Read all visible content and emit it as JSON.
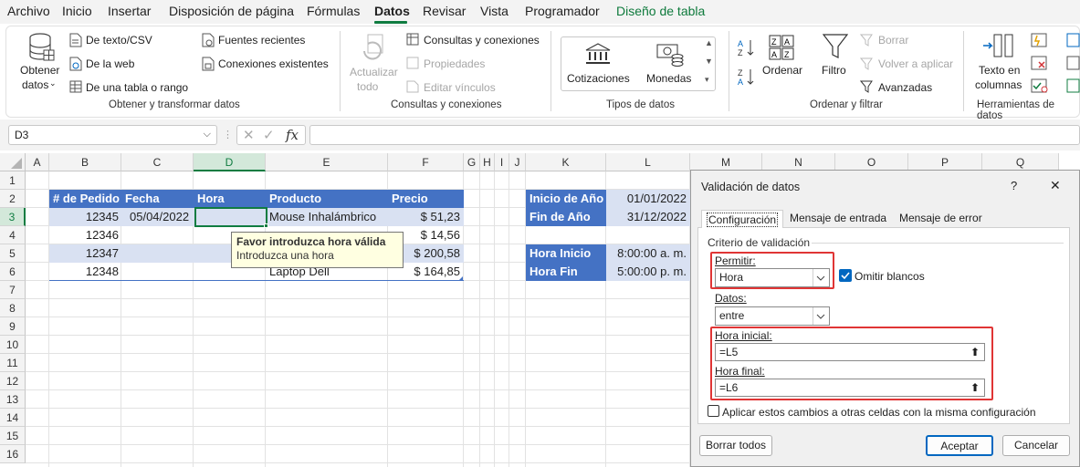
{
  "menu": {
    "items": [
      "Archivo",
      "Inicio",
      "Insertar",
      "Disposición de página",
      "Fórmulas",
      "Datos",
      "Revisar",
      "Vista",
      "Programador",
      "Diseño de tabla"
    ]
  },
  "ribbon": {
    "obtener": {
      "big_label_1": "Obtener",
      "big_label_2": "datos",
      "texto_csv": "De texto/CSV",
      "web": "De la web",
      "tabla_rango": "De una tabla o rango",
      "fuentes_recientes": "Fuentes recientes",
      "conexiones_existentes": "Conexiones existentes",
      "group_label": "Obtener y transformar datos"
    },
    "consultas": {
      "actualizar_1": "Actualizar",
      "actualizar_2": "todo",
      "consultas_conexiones": "Consultas y conexiones",
      "propiedades": "Propiedades",
      "editar_vinculos": "Editar vínculos",
      "group_label": "Consultas y conexiones"
    },
    "tipos": {
      "cotizaciones": "Cotizaciones",
      "monedas": "Monedas",
      "group_label": "Tipos de datos"
    },
    "ordenar": {
      "ordenar": "Ordenar",
      "filtro": "Filtro",
      "borrar": "Borrar",
      "volver_aplicar": "Volver a aplicar",
      "avanzadas": "Avanzadas",
      "group_label": "Ordenar y filtrar"
    },
    "herramientas": {
      "texto_1": "Texto en",
      "texto_2": "columnas",
      "group_label": "Herramientas de datos"
    }
  },
  "formula_bar": {
    "name_box": "D3",
    "fx": "fx",
    "formula": ""
  },
  "columns": [
    "A",
    "B",
    "C",
    "D",
    "E",
    "F",
    "G",
    "H",
    "I",
    "J",
    "K",
    "L",
    "M",
    "N",
    "O",
    "P",
    "Q"
  ],
  "rows": [
    "1",
    "2",
    "3",
    "4",
    "5",
    "6",
    "7",
    "8",
    "9",
    "10",
    "11",
    "12",
    "13",
    "14",
    "15",
    "16"
  ],
  "table": {
    "headers": [
      "# de Pedido",
      "Fecha",
      "Hora",
      "Producto",
      "Precio"
    ],
    "rows": [
      [
        "12345",
        "05/04/2022",
        "",
        "Mouse Inhalámbrico",
        "$ 51,23"
      ],
      [
        "12346",
        "",
        "",
        "",
        "$ 14,56"
      ],
      [
        "12347",
        "",
        "",
        "",
        "$ 200,58"
      ],
      [
        "12348",
        "",
        "",
        "Laptop Dell",
        "$ 164,85"
      ]
    ]
  },
  "params": {
    "inicio_label": "Inicio de Año",
    "inicio_value": "01/01/2022",
    "fin_label": "Fin de Año",
    "fin_value": "31/12/2022",
    "hora_inicio_label": "Hora Inicio",
    "hora_inicio_value": "8:00:00 a. m.",
    "hora_fin_label": "Hora Fin",
    "hora_fin_value": "5:00:00 p. m."
  },
  "tooltip": {
    "title": "Favor introduzca hora válida",
    "message": "Introduzca una hora"
  },
  "dialog": {
    "title": "Validación de datos",
    "help": "?",
    "close": "✕",
    "tabs": [
      "Configuración",
      "Mensaje de entrada",
      "Mensaje de error"
    ],
    "section": "Criterio de validación",
    "permitir_label": "Permitir:",
    "permitir_value": "Hora",
    "omitir_label": "Omitir blancos",
    "omitir_checked": true,
    "datos_label": "Datos:",
    "datos_value": "entre",
    "hora_inicial_label": "Hora inicial:",
    "hora_inicial_value": "=L5",
    "hora_final_label": "Hora final:",
    "hora_final_value": "=L6",
    "aplicar_label": "Aplicar estos cambios a otras celdas con la misma configuración",
    "aplicar_checked": false,
    "borrar_todos": "Borrar todos",
    "aceptar": "Aceptar",
    "cancelar": "Cancelar"
  },
  "colors": {
    "excel_green": "#107c41",
    "table_header": "#4472c4",
    "table_band": "#d9e1f2",
    "highlight_red": "#e03535",
    "accent_blue": "#0067c0"
  }
}
